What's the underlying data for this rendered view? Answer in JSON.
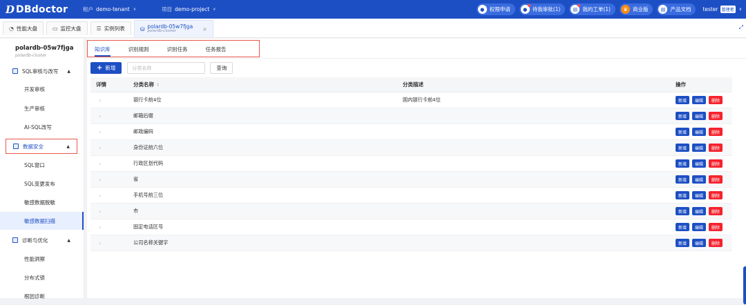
{
  "header": {
    "logo_mark": "D",
    "logo_text": "DBdoctor",
    "tenant_label": "租户",
    "tenant_value": "demo-tenant",
    "project_label": "项目",
    "project_value": "demo-project",
    "actions": [
      {
        "label": "权限申请",
        "icon": "lock-icon",
        "glyph": "🔒",
        "dot": false
      },
      {
        "label": "待我审批(1)",
        "icon": "user-icon",
        "glyph": "👤",
        "dot": true
      },
      {
        "label": "我的工单(1)",
        "icon": "document-icon",
        "glyph": "▤",
        "dot": true
      },
      {
        "label": "商业版",
        "icon": "crown-icon",
        "glyph": "♛",
        "dot": false
      },
      {
        "label": "产品文档",
        "icon": "book-icon",
        "glyph": "▤",
        "dot": false
      }
    ],
    "user": "tester",
    "role": "管理者"
  },
  "page_tabs": [
    {
      "label": "性能大盘",
      "icon": "dashboard-icon",
      "glyph": "◔"
    },
    {
      "label": "监控大盘",
      "icon": "monitor-icon",
      "glyph": "▭"
    },
    {
      "label": "实例列表",
      "icon": "list-icon",
      "glyph": "☰"
    },
    {
      "label": "polardb-05w7fjga",
      "sub": "polardb-cluster",
      "icon": "database-icon",
      "glyph": "⛁"
    }
  ],
  "sidebar": {
    "instance_name": "polardb-05w7fjga",
    "instance_type": "polardb-cluster",
    "groups": [
      {
        "label": "SQL审核与改写"
      },
      {
        "label": "数据安全"
      },
      {
        "label": "诊断与优化"
      }
    ],
    "items": [
      {
        "label": "开发审核"
      },
      {
        "label": "生产审核"
      },
      {
        "label": "AI-SQL改写"
      },
      {
        "label": "SQL窗口"
      },
      {
        "label": "SQL变更发布"
      },
      {
        "label": "敏感数据脱敏"
      },
      {
        "label": "敏感数据扫描"
      },
      {
        "label": "性能洞察"
      },
      {
        "label": "分布式锁"
      },
      {
        "label": "根因诊断"
      }
    ]
  },
  "subtabs": [
    "知识库",
    "识别规则",
    "识别任务",
    "任务报告"
  ],
  "toolbar": {
    "add_label": "新增",
    "search_placeholder": "分类名称",
    "query_label": "查询"
  },
  "table": {
    "columns": [
      "详情",
      "分类名称",
      "分类描述",
      "操作"
    ],
    "rows": [
      {
        "name": "银行卡前4位",
        "desc": "国内银行卡前4位"
      },
      {
        "name": "邮箱后缀",
        "desc": ""
      },
      {
        "name": "邮政编码",
        "desc": ""
      },
      {
        "name": "身份证前六位",
        "desc": ""
      },
      {
        "name": "行政区划代码",
        "desc": ""
      },
      {
        "name": "省",
        "desc": ""
      },
      {
        "name": "手机号前三位",
        "desc": ""
      },
      {
        "name": "市",
        "desc": ""
      },
      {
        "name": "固定电话区号",
        "desc": ""
      },
      {
        "name": "公司名称关键字",
        "desc": ""
      }
    ],
    "row_actions": [
      "新增",
      "编辑",
      "删除"
    ]
  },
  "colors": {
    "primary": "#1d4fc4",
    "danger": "#f5222d",
    "highlight": "#e8574a"
  }
}
